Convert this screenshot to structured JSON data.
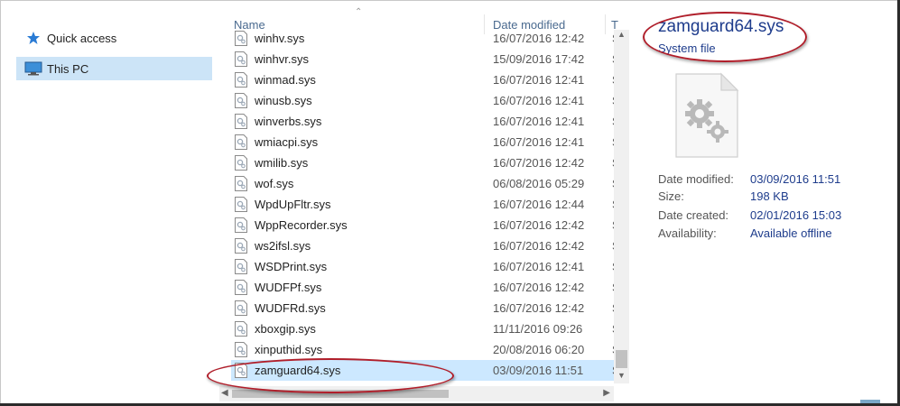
{
  "nav": {
    "items": [
      {
        "label": "Quick access",
        "icon": "star-icon"
      },
      {
        "label": "This PC",
        "icon": "computer-icon",
        "selected": true
      }
    ]
  },
  "list": {
    "columns": {
      "name": "Name",
      "date_modified": "Date modified",
      "type_truncated": "T"
    },
    "rows": [
      {
        "name": "winhv.sys",
        "date": "16/07/2016 12:42",
        "type": "S"
      },
      {
        "name": "winhvr.sys",
        "date": "15/09/2016 17:42",
        "type": "S"
      },
      {
        "name": "winmad.sys",
        "date": "16/07/2016 12:41",
        "type": "S"
      },
      {
        "name": "winusb.sys",
        "date": "16/07/2016 12:41",
        "type": "S"
      },
      {
        "name": "winverbs.sys",
        "date": "16/07/2016 12:41",
        "type": "S"
      },
      {
        "name": "wmiacpi.sys",
        "date": "16/07/2016 12:41",
        "type": "S"
      },
      {
        "name": "wmilib.sys",
        "date": "16/07/2016 12:42",
        "type": "S"
      },
      {
        "name": "wof.sys",
        "date": "06/08/2016 05:29",
        "type": "S"
      },
      {
        "name": "WpdUpFltr.sys",
        "date": "16/07/2016 12:44",
        "type": "S"
      },
      {
        "name": "WppRecorder.sys",
        "date": "16/07/2016 12:42",
        "type": "S"
      },
      {
        "name": "ws2ifsl.sys",
        "date": "16/07/2016 12:42",
        "type": "S"
      },
      {
        "name": "WSDPrint.sys",
        "date": "16/07/2016 12:41",
        "type": "S"
      },
      {
        "name": "WUDFPf.sys",
        "date": "16/07/2016 12:42",
        "type": "S"
      },
      {
        "name": "WUDFRd.sys",
        "date": "16/07/2016 12:42",
        "type": "S"
      },
      {
        "name": "xboxgip.sys",
        "date": "11/11/2016 09:26",
        "type": "S"
      },
      {
        "name": "xinputhid.sys",
        "date": "20/08/2016 06:20",
        "type": "S"
      },
      {
        "name": "zamguard64.sys",
        "date": "03/09/2016 11:51",
        "type": "S",
        "selected": true
      }
    ]
  },
  "details": {
    "title": "zamguard64.sys",
    "type": "System file",
    "props": [
      {
        "key": "Date modified:",
        "value": "03/09/2016 11:51"
      },
      {
        "key": "Size:",
        "value": "198 KB"
      },
      {
        "key": "Date created:",
        "value": "02/01/2016 15:03"
      },
      {
        "key": "Availability:",
        "value": "Available offline"
      }
    ]
  },
  "colors": {
    "accent_text": "#1e3c8c",
    "selection": "#cce8ff",
    "highlight_ellipse": "#b01e2a"
  }
}
